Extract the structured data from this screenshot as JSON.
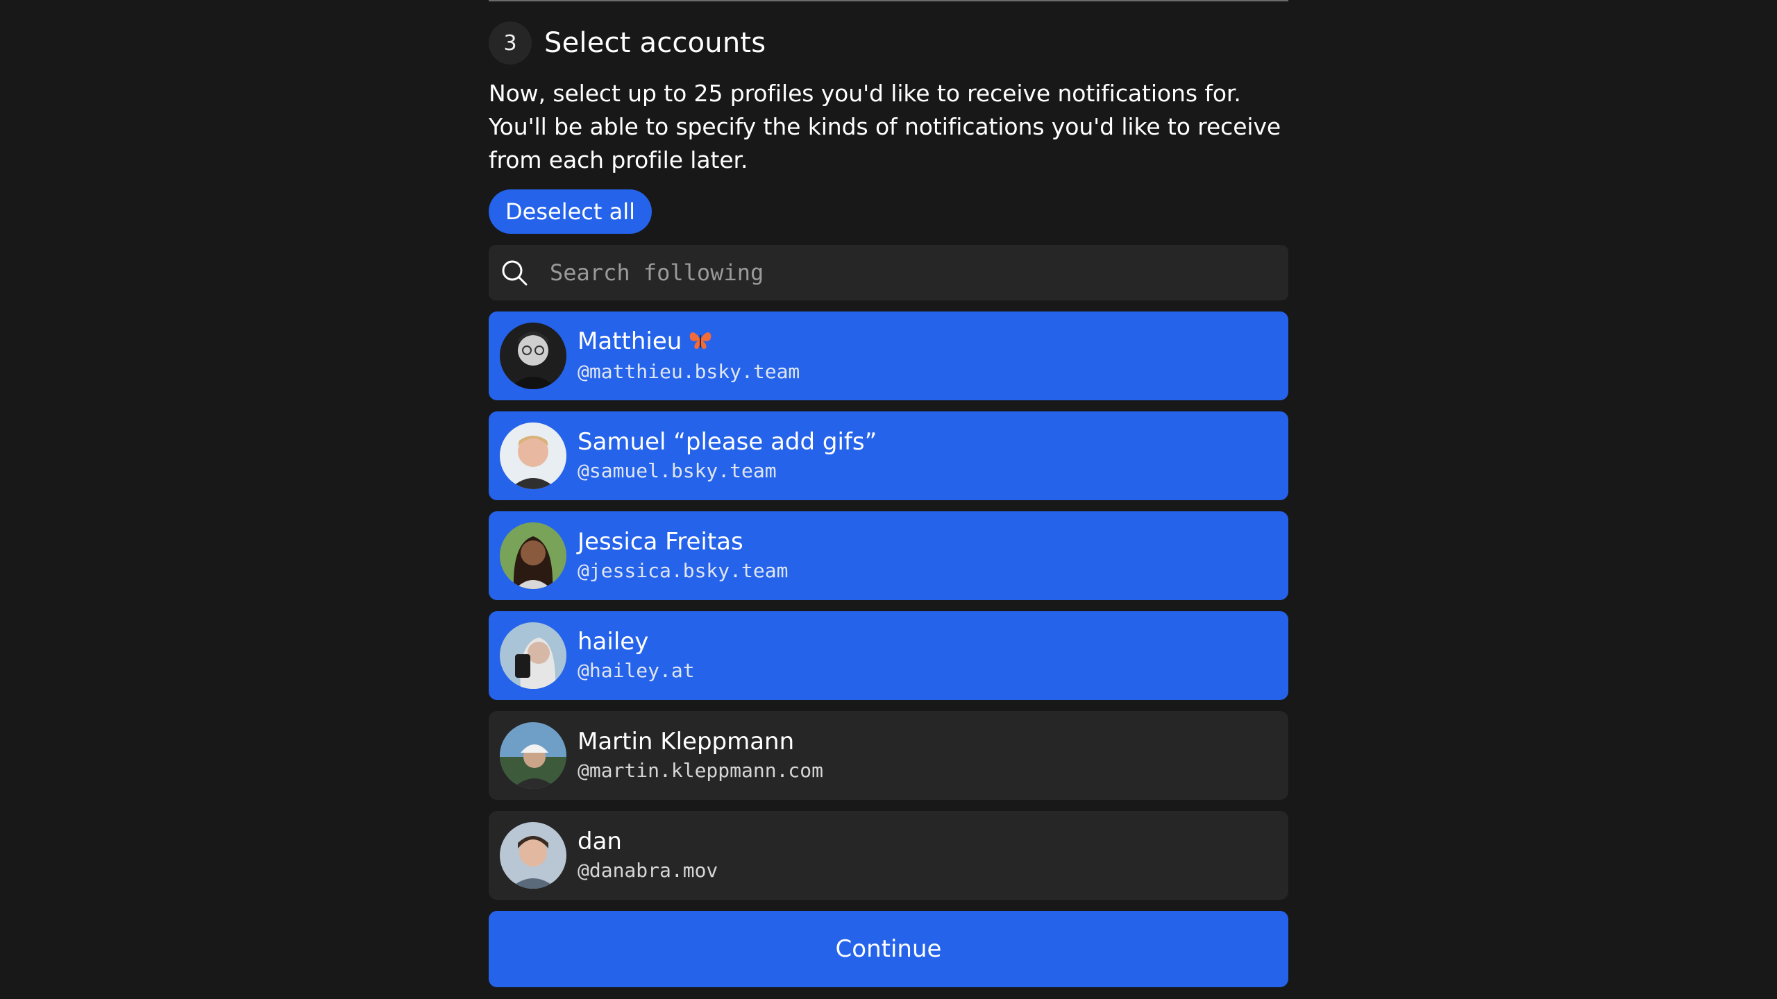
{
  "step": {
    "number": "3",
    "title": "Select accounts"
  },
  "intro_text": "Now, select up to 25 profiles you'd like to receive notifications for. You'll be able to specify the kinds of notifications you'd like to receive from each profile later.",
  "deselect_all_label": "Deselect all",
  "search": {
    "placeholder": "Search following",
    "value": ""
  },
  "accounts": [
    {
      "name": "Matthieu",
      "emoji": "butterfly",
      "handle": "@matthieu.bsky.team",
      "selected": true
    },
    {
      "name": "Samuel “please add gifs”",
      "handle": "@samuel.bsky.team",
      "selected": true
    },
    {
      "name": "Jessica Freitas",
      "handle": "@jessica.bsky.team",
      "selected": true
    },
    {
      "name": "hailey",
      "handle": "@hailey.at",
      "selected": true
    },
    {
      "name": "Martin Kleppmann",
      "handle": "@martin.kleppmann.com",
      "selected": false
    },
    {
      "name": "dan",
      "handle": "@danabra.mov",
      "selected": false
    }
  ],
  "continue_label": "Continue",
  "colors": {
    "accent": "#2563eb",
    "background": "#181818",
    "surface": "#262626"
  }
}
